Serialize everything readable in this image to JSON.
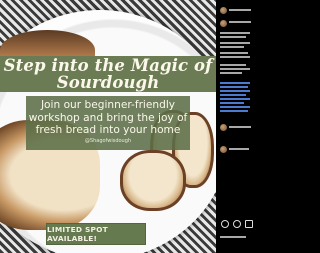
{
  "post": {
    "headline": "Step into the Magic of Sourdough",
    "subtext": "Join our beginner-friendly workshop and bring the joy of fresh bread into your home",
    "handle": "@Shagofwisdough",
    "cta_label": "LIMITED SPOT AVAILABLE!"
  },
  "colors": {
    "accent_green": "#6b7c54",
    "button_green": "#667a50",
    "text_cream": "#fbf7ea",
    "hashtag_blue": "#4a7bd0"
  },
  "sidebar": {
    "username": "shootistdough...",
    "like_icon": "heart-icon",
    "comment_icon": "comment-icon",
    "share_icon": "send-icon",
    "save_icon": "bookmark-icon"
  }
}
